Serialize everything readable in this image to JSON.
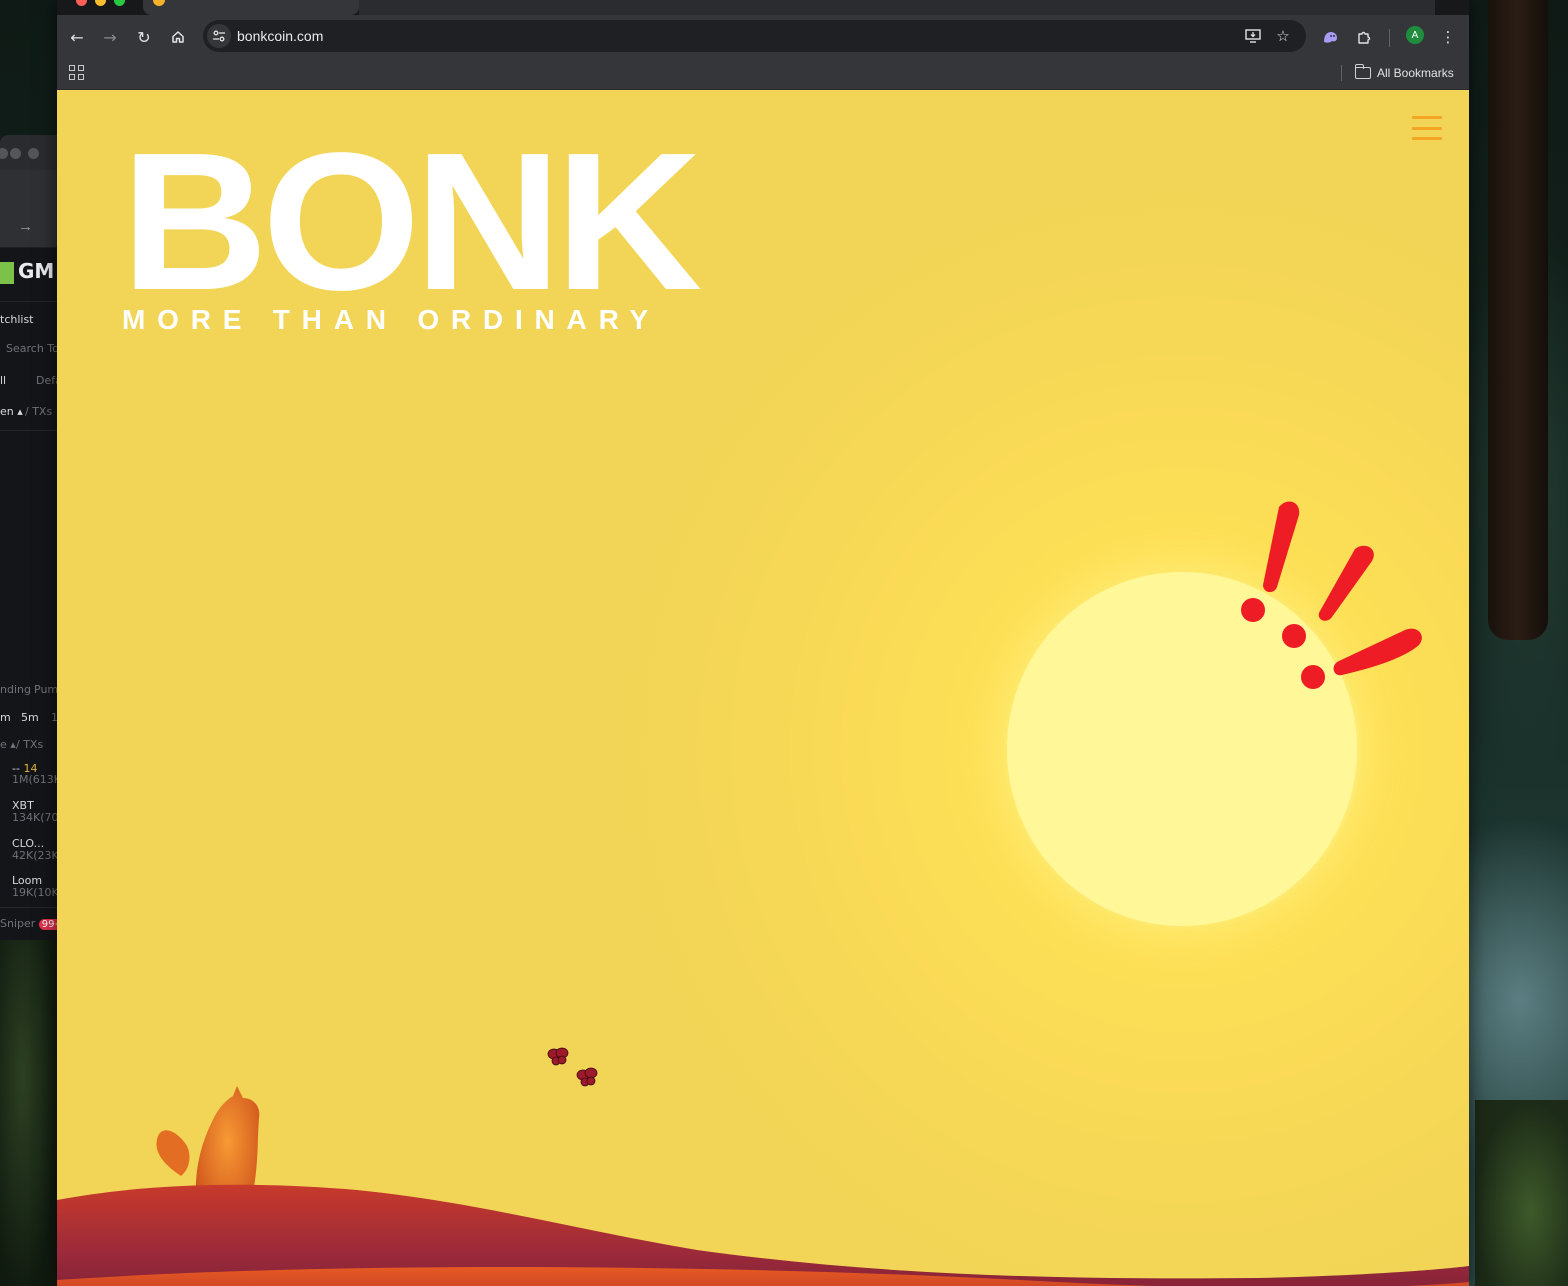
{
  "browser": {
    "url": "bonkcoin.com",
    "bookmarks_label": "All Bookmarks",
    "profile_initial": "A"
  },
  "icons": {
    "back": "back-arrow-icon",
    "forward": "forward-arrow-icon",
    "reload": "reload-icon",
    "home": "home-icon",
    "site_info": "tune-icon",
    "install": "install-app-icon",
    "bookmark": "star-icon",
    "extension_ghost": "ghost-extension-icon",
    "extensions": "puzzle-icon",
    "menu": "kebab-menu-icon",
    "apps": "apps-grid-icon",
    "folder": "folder-icon",
    "site_menu": "hamburger-menu-icon"
  },
  "page": {
    "logo_text": "BONK",
    "tagline": "MORE THAN ORDINARY"
  },
  "background_window": {
    "app_name": "GM",
    "watchlist": "tchlist",
    "search_placeholder": "Search To",
    "filter_all": "ll",
    "filter_default": "Defa",
    "column_token": "en",
    "column_txs": "/ TXs",
    "tabs": [
      "nding",
      "Pum"
    ],
    "timeframes": [
      "m",
      "5m",
      "1"
    ],
    "sort_label": "e",
    "sort_txs": "/ TXs",
    "rows": [
      {
        "name": "--",
        "extra": "14",
        "sub": "1M(613K"
      },
      {
        "name": "XBT",
        "extra": "",
        "sub": "134K(70"
      },
      {
        "name": "CLO...",
        "extra": "",
        "sub": "42K(23K"
      },
      {
        "name": "Loom",
        "extra": "",
        "sub": "19K(10K"
      }
    ],
    "footer_label": "Sniper",
    "footer_badge": "99+"
  },
  "colors": {
    "page_background": "#7f3935",
    "sun": "#fff798",
    "exclamation": "#ee1c24",
    "hamburger": "#f5a524",
    "toolbar": "#35363a"
  }
}
